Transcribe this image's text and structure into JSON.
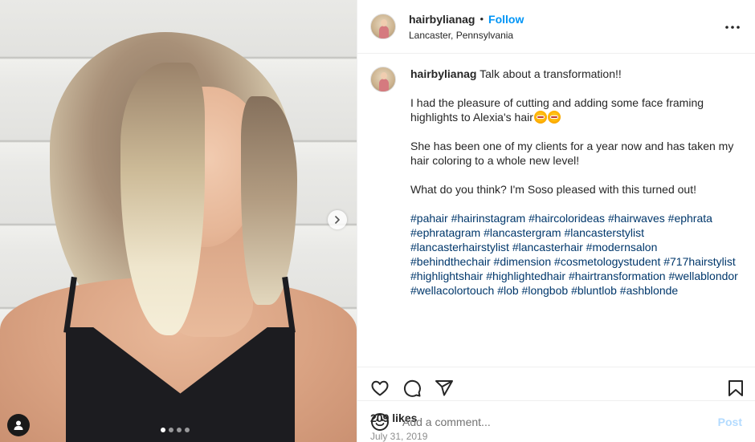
{
  "header": {
    "username": "hairbylianag",
    "separator": "•",
    "follow_label": "Follow",
    "location": "Lancaster, Pennsylvania"
  },
  "caption": {
    "author": "hairbylianag",
    "intro": "Talk about a transformation!!",
    "paragraph_1": "I had the pleasure of cutting and adding some face framing highlights to Alexia's hair",
    "paragraph_2": "She has been one of my clients for a year now and has taken my hair coloring to a whole new level!",
    "paragraph_3": "What do you think? I'm Soso pleased with this turned out!",
    "hashtags": [
      "#pahair",
      "#hairinstagram",
      "#haircolorideas",
      "#hairwaves",
      "#ephrata",
      "#ephratagram",
      "#lancastergram",
      "#lancasterstylist",
      "#lancasterhairstylist",
      "#lancasterhair",
      "#modernsalon",
      "#behindthechair",
      "#dimension",
      "#cosmetologystudent",
      "#717hairstylist",
      "#highlightshair",
      "#highlightedhair",
      "#hairtransformation",
      "#wellablondor",
      "#wellacolortouch",
      "#lob",
      "#longbob",
      "#bluntlob",
      "#ashblonde"
    ]
  },
  "actions": {
    "icons": [
      "heart-icon",
      "comment-icon",
      "share-icon",
      "bookmark-icon"
    ]
  },
  "stats": {
    "likes": "209 likes",
    "date": "July 31, 2019"
  },
  "comment": {
    "placeholder": "Add a comment...",
    "post_label": "Post"
  },
  "carousel": {
    "dot_count": 4,
    "active_index": 0
  },
  "colors": {
    "accent": "#0095f6",
    "hashtag": "#00376b",
    "post_disabled": "#b3dbff",
    "muted": "#8e8e8e"
  }
}
